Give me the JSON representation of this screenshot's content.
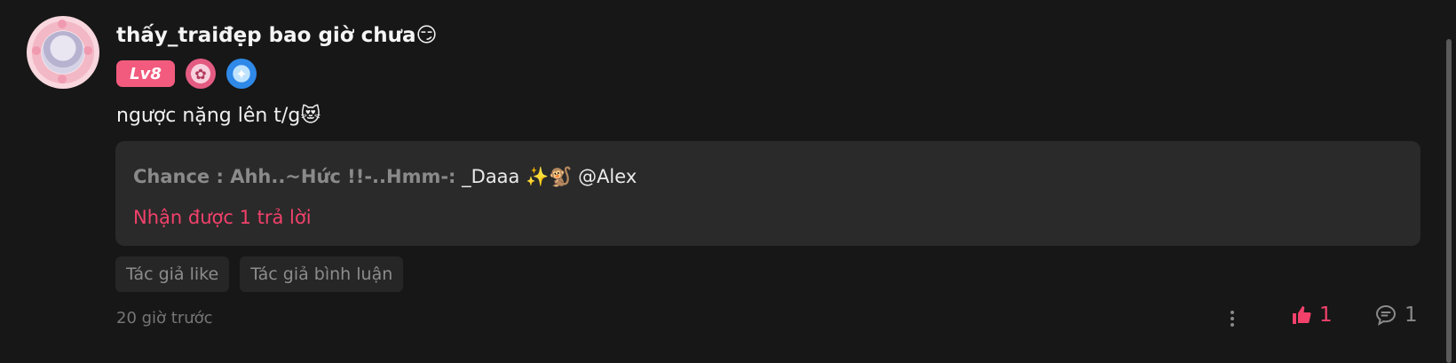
{
  "comment": {
    "username": "thấy_traiđẹp bao giờ chưa",
    "username_emoji": "😏",
    "level_badge": "Lv8",
    "text": "ngược nặng lên t/g",
    "text_emoji": "😻",
    "reply_preview": {
      "author": "Chance : Ahh..~Hức !!-..Hmm-:",
      "content": " _Daaa ✨🐒 @Alex",
      "reply_count_label": "Nhận được 1 trả lời"
    },
    "tags": [
      "Tác giả like",
      "Tác giả bình luận"
    ],
    "timestamp": "20 giờ trước",
    "likes": "1",
    "replies": "1"
  },
  "colors": {
    "background": "#171717",
    "accent": "#f2416b",
    "level_badge": "#f25b7e",
    "reply_box": "#2a2a2a"
  },
  "icons": {
    "more": "more-vertical-icon",
    "like": "thumbs-up-icon",
    "reply": "comment-bubble-icon"
  }
}
